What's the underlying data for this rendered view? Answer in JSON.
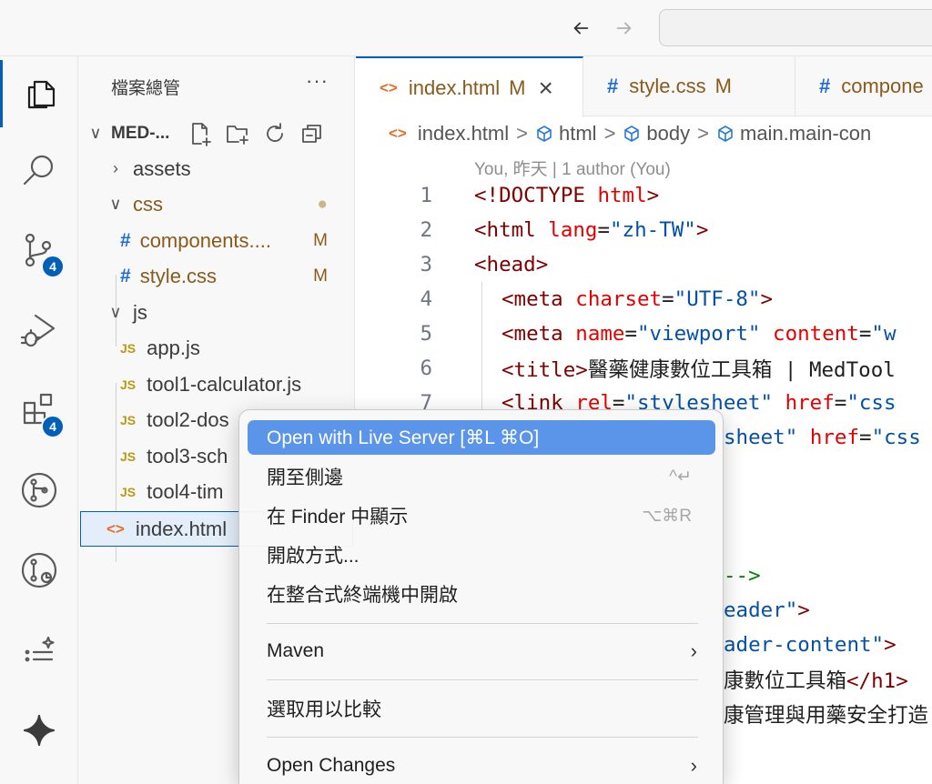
{
  "nav": {
    "back": "←",
    "forward": "→"
  },
  "activity": {
    "scm_badge": "4",
    "extensions_badge": "4"
  },
  "sidebar": {
    "title": "檔案總管",
    "more": "···",
    "root": "MED-...",
    "items": [
      {
        "label": "assets",
        "type": "folder",
        "state": "collapsed"
      },
      {
        "label": "css",
        "type": "folder",
        "state": "expanded",
        "decoration": "●"
      },
      {
        "label": "components....",
        "type": "css",
        "status": "M"
      },
      {
        "label": "style.css",
        "type": "css",
        "status": "M"
      },
      {
        "label": "js",
        "type": "folder",
        "state": "expanded"
      },
      {
        "label": "app.js",
        "type": "js"
      },
      {
        "label": "tool1-calculator.js",
        "type": "js"
      },
      {
        "label": "tool2-dos",
        "type": "js"
      },
      {
        "label": "tool3-sch",
        "type": "js"
      },
      {
        "label": "tool4-tim",
        "type": "js"
      },
      {
        "label": "index.html",
        "type": "html",
        "selected": true
      }
    ]
  },
  "tabs": [
    {
      "icon": "<>",
      "label": "index.html",
      "status": "M",
      "close": "×",
      "active": true
    },
    {
      "icon": "#",
      "label": "style.css",
      "status": "M"
    },
    {
      "icon": "#",
      "label": "compone"
    }
  ],
  "breadcrumb": {
    "file": "index.html",
    "items": [
      "html",
      "body",
      "main.main-con"
    ],
    "sep": ">"
  },
  "codelens": "You, 昨天 | 1 author (You)",
  "line_numbers": [
    "1",
    "2",
    "3",
    "4",
    "5",
    "6",
    "7"
  ],
  "code": {
    "l1": {
      "open": "<!DOCTYPE ",
      "attr": "html",
      "close": ">"
    },
    "l2": {
      "open": "<html ",
      "attr": "lang",
      "eq": "=",
      "val": "\"zh-TW\"",
      "close": ">"
    },
    "l3": {
      "open": "<head>"
    },
    "l4": {
      "open": "<meta ",
      "attr": "charset",
      "eq": "=",
      "val": "\"UTF-8\"",
      "close": ">"
    },
    "l5": {
      "open": "<meta ",
      "attr1": "name",
      "eq1": "=",
      "val1": "\"viewport\"",
      "attr2": " content",
      "eq2": "=",
      "val2": "\"w"
    },
    "l6": {
      "open": "<title>",
      "text": "醫藥健康數位工具箱 | MedTool"
    },
    "l7": {
      "open": "<link ",
      "attr1": "rel",
      "eq1": "=",
      "val1": "\"stylesheet\"",
      "attr2": " href",
      "eq2": "=",
      "val2": "\"css"
    },
    "frag1": {
      "attr": "sheet\"",
      "attr2": " href",
      "eq": "=",
      "val": "\"css"
    },
    "frag2": {
      "cmt": "-->"
    },
    "frag3": {
      "val": "eader\"",
      "close": ">"
    },
    "frag4": {
      "val": "ader-content\"",
      "close": ">"
    },
    "frag5": {
      "text": "康數位工具箱",
      "close": "</h1>"
    },
    "frag6": {
      "text": "康管理與用藥安全打造"
    }
  },
  "context_menu": {
    "items": [
      {
        "label": "Open with Live Server [⌘L ⌘O]",
        "highlighted": true
      },
      {
        "label": "開至側邊",
        "shortcut": "^↵"
      },
      {
        "label": "在 Finder 中顯示",
        "shortcut": "⌥⌘R"
      },
      {
        "label": "開啟方式..."
      },
      {
        "label": "在整合式終端機中開啟"
      },
      {
        "label": "Maven",
        "submenu": "›"
      },
      {
        "label": "選取用以比較"
      },
      {
        "label": "Open Changes",
        "submenu": "›"
      }
    ]
  },
  "colors": {
    "accent": "#005fb8",
    "menu_highlight": "#5b95ea",
    "modified": "#8a5a1c"
  }
}
